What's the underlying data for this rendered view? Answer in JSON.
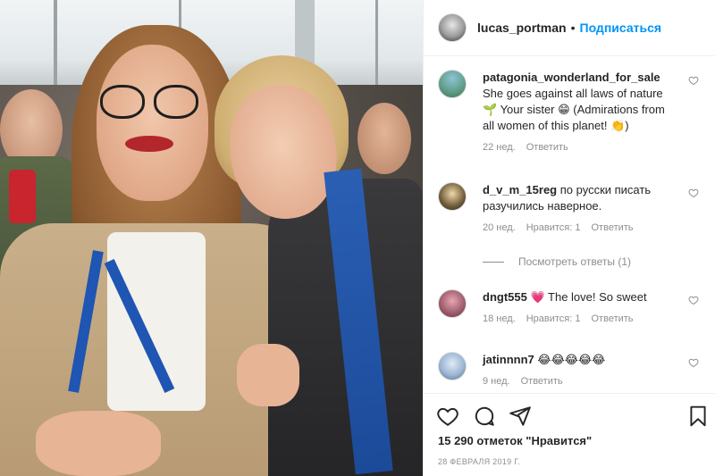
{
  "header": {
    "username": "lucas_portman",
    "separator": "•",
    "follow_label": "Подписаться"
  },
  "comments": [
    {
      "author": "patagonia_wonderland_for_sale",
      "text": "She goes against all laws of nature 🌱 Your sister 😁 (Admirations from all women of this planet! 👏)",
      "time": "22 нед.",
      "reply_label": "Ответить"
    },
    {
      "author": "d_v_m_15reg",
      "text": "по русски писать разучились наверное.",
      "time": "20 нед.",
      "likes": "Нравится: 1",
      "reply_label": "Ответить"
    },
    {
      "author": "dngt555",
      "text": "💗 The love! So sweet",
      "time": "18 нед.",
      "likes": "Нравится: 1",
      "reply_label": "Ответить"
    },
    {
      "author": "jatinnnn7",
      "text": "😂😂😂😂😂",
      "time": "9 нед.",
      "reply_label": "Ответить"
    }
  ],
  "view_replies": "Посмотреть ответы (1)",
  "likes_text": "15 290 отметок \"Нравится\"",
  "date_text": "28 ФЕВРАЛЯ 2019 Г.",
  "icons": {
    "like": "heart-icon",
    "comment": "comment-icon",
    "share": "paper-plane-icon",
    "save": "bookmark-icon",
    "comment_like": "small-heart-icon"
  },
  "colors": {
    "accent": "#0095f6",
    "text": "#262626",
    "muted": "#8e8e8e",
    "border": "#efefef"
  }
}
